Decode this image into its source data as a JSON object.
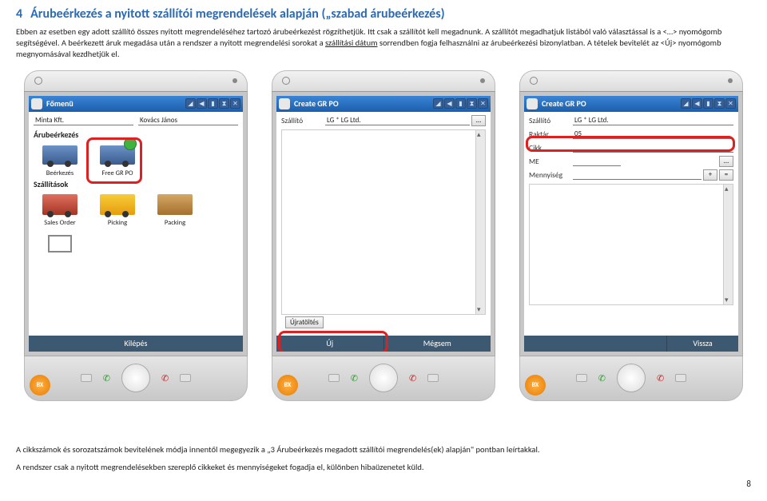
{
  "section": {
    "num": "4",
    "title": "Árubeérkezés a nyitott szállítói megrendelések alapján („szabad árubeérkezés)"
  },
  "body": {
    "p1a": "Ebben az esetben egy adott szállító összes nyitott megrendeléséhez tartozó árubeérkezést rögzíthetjük. Itt csak a szállítót kell megadnunk. A szállítót megadhatjuk listából való választással is a <…> nyomógomb segítségével. A beérkezett áruk megadása után a rendszer a nyitott megrendelési sorokat a ",
    "p1u": "szállítási dátum",
    "p1b": " sorrendben fogja felhasználni az árubeérkezési bizonylatban. A tételek bevitelét az <Új> nyomógomb megnyomásával kezdhetjük el."
  },
  "dev1": {
    "title": "Főmenü",
    "company": "Minta Kft.",
    "user": "Kovács János",
    "sec1": "Árubeérkezés",
    "i1": "Beérkezés",
    "i2": "Free GR PO",
    "sec2": "Szállítások",
    "i3": "Sales Order",
    "i4": "Picking",
    "i5": "Packing",
    "exit": "Kilépés"
  },
  "dev2": {
    "title": "Create GR PO",
    "l_supplier": "Szállító",
    "v_supplier": "LG * LG Ltd.",
    "btn_reload": "Újratöltés",
    "btn_new": "Új",
    "btn_cancel": "Mégsem"
  },
  "dev3": {
    "title": "Create GR PO",
    "l_supplier": "Szállító",
    "v_supplier": "LG * LG Ltd.",
    "l_whs": "Raktár",
    "v_whs": "05",
    "l_item": "Cikk",
    "l_me": "ME",
    "l_qty": "Mennyiség",
    "plus": "+",
    "eq": "=",
    "btn_back": "Vissza"
  },
  "notes": {
    "n1": "A cikkszámok és sorozatszámok bevitelének módja innentől megegyezik a „3  Árubeérkezés megadott szállítói megrendelés(ek) alapján\" pontban leírtakkal.",
    "n2": "A rendszer csak a nyitott megrendelésekben szereplő cikkeket és mennyiségeket fogadja el, különben hibaüzenetet küld."
  },
  "page": "8"
}
